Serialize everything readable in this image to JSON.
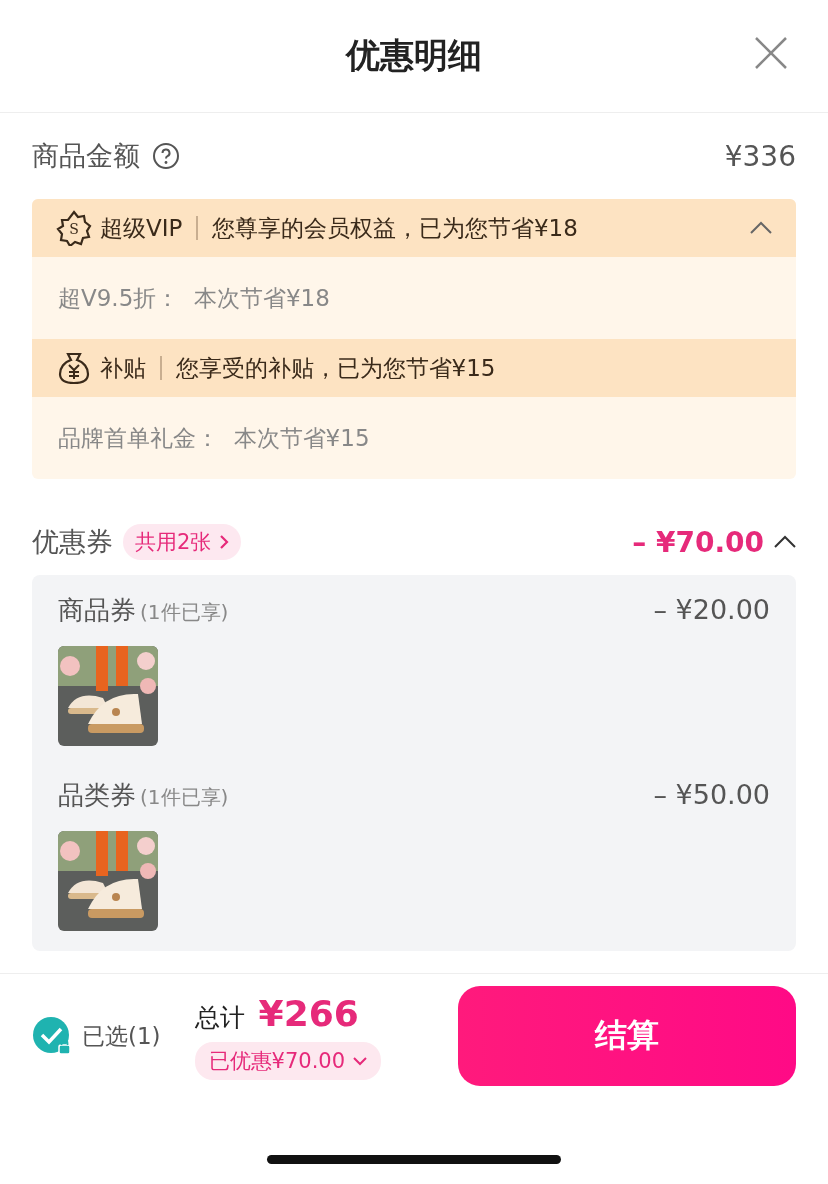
{
  "title": "优惠明细",
  "goods_amount": {
    "label": "商品金额",
    "value": "¥336"
  },
  "benefits": [
    {
      "kind": "vip",
      "badge_letter": "S",
      "name": "超级VIP",
      "desc": "您尊享的会员权益，已为您节省¥18",
      "expanded": true,
      "detail_label": "超V9.5折：",
      "detail_value": "本次节省¥18"
    },
    {
      "kind": "subsidy",
      "name": "补贴",
      "desc": "您享受的补贴，已为您节省¥15",
      "detail_label": "品牌首单礼金：",
      "detail_value": "本次节省¥15"
    }
  ],
  "coupons": {
    "label": "优惠券",
    "tag": "共用2张",
    "total": "– ¥70.00",
    "expanded": true,
    "items": [
      {
        "name": "商品券",
        "note": "(1件已享)",
        "amount": "– ¥20.00"
      },
      {
        "name": "品类券",
        "note": "(1件已享)",
        "amount": "– ¥50.00"
      }
    ]
  },
  "footer": {
    "selected": {
      "label": "已选(1)",
      "checked": true
    },
    "total_label": "总计",
    "total": "¥266",
    "discount": "已优惠¥70.00",
    "discount_expanded": false,
    "checkout": "结算"
  }
}
